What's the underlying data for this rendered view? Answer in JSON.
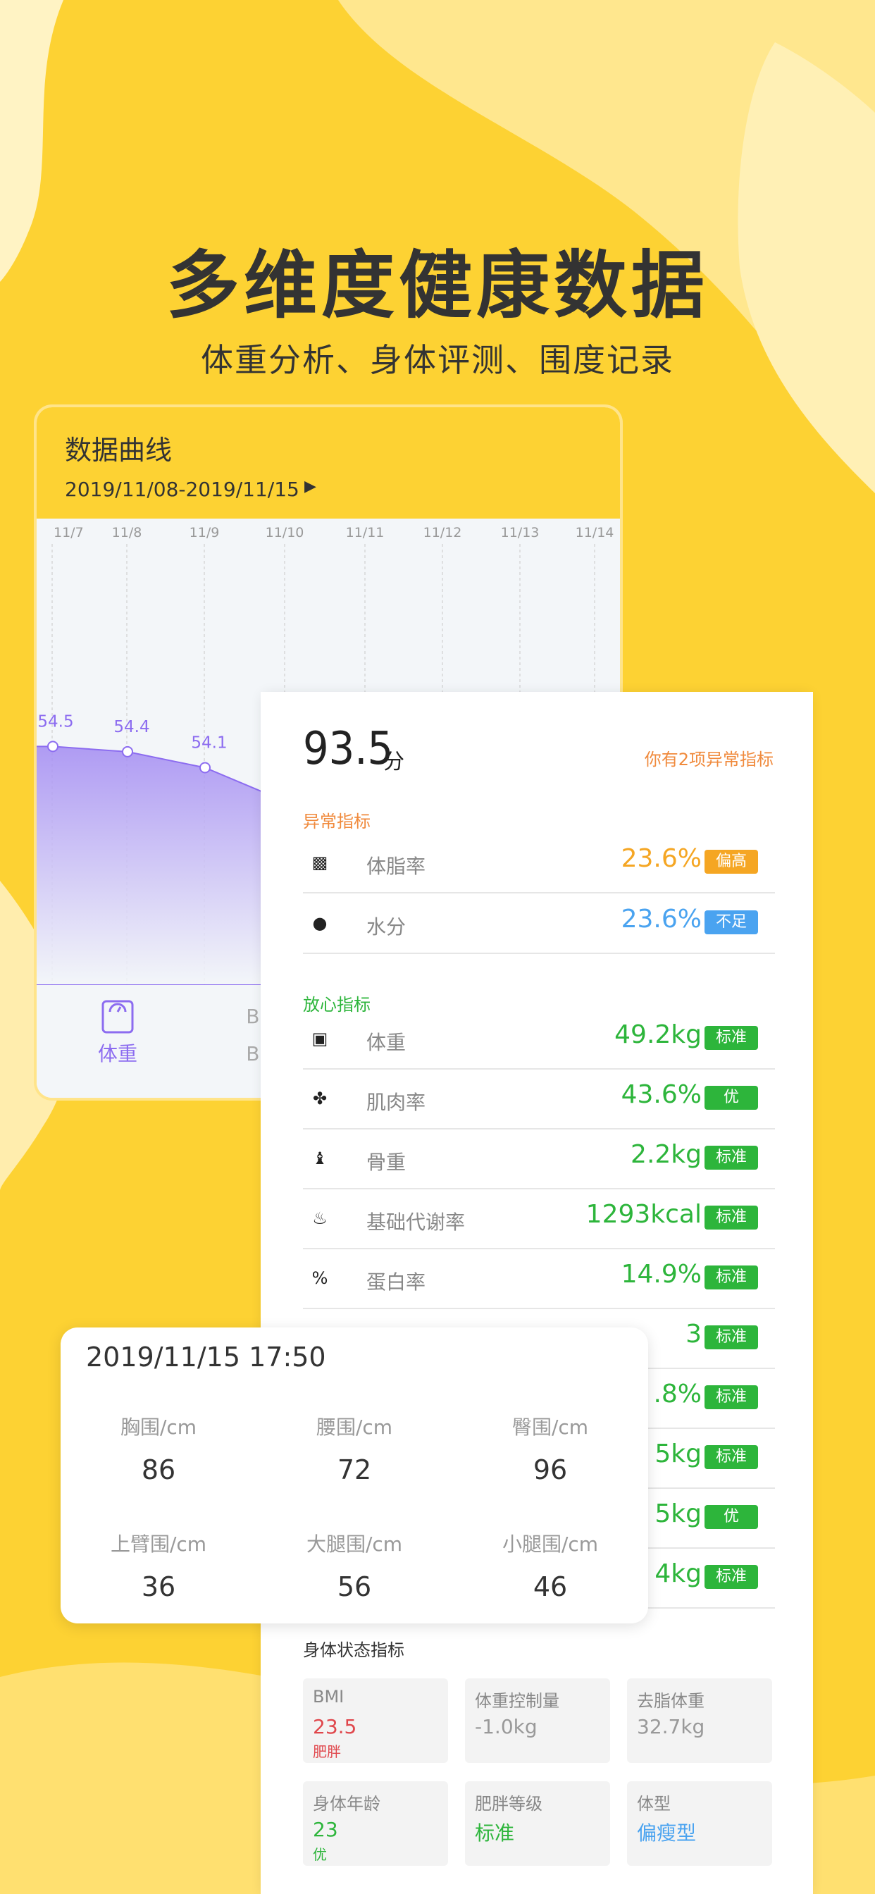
{
  "hero": {
    "title": "多维度健康数据",
    "subtitle": "体重分析、身体评测、围度记录"
  },
  "chart_card": {
    "title": "数据曲线",
    "date_range": "2019/11/08-2019/11/15",
    "arrow": "▶",
    "tabs": [
      {
        "label": "体重",
        "icon": "scale-icon",
        "active": true
      },
      {
        "label": "BMI",
        "icon": "",
        "active": false
      }
    ],
    "tab_partial_top": "BMI",
    "accent_color": "#8C6CF0"
  },
  "chart_data": {
    "type": "area",
    "x": [
      "11/7",
      "11/8",
      "11/9",
      "11/10",
      "11/11",
      "11/12",
      "11/13",
      "11/14"
    ],
    "series": [
      {
        "values": [
          54.5,
          54.4,
          54.1,
          null,
          null,
          null,
          null,
          null
        ]
      }
    ],
    "data_labels": [
      "54.5",
      "54.4",
      "54.1"
    ],
    "ylim": [
      50,
      58
    ],
    "grid": true,
    "color": "#8C6CF0"
  },
  "report": {
    "score": "93.5",
    "score_unit": "分",
    "abnormal_note": "你有2项异常指标",
    "abnormal_label": "异常指标",
    "normal_label": "放心指标",
    "colors": {
      "orange": "#F5A623",
      "blue": "#4AA3F0",
      "green": "#2DB53B",
      "section_orange": "#F08A3C"
    },
    "abnormal": [
      {
        "icon": "fat-grid-icon",
        "label": "体脂率",
        "value": "23.6%",
        "badge": "偏高",
        "color": "#F5A623"
      },
      {
        "icon": "water-drop-icon",
        "label": "水分",
        "value": "23.6%",
        "badge": "不足",
        "color": "#4AA3F0"
      }
    ],
    "normal": [
      {
        "icon": "scale-icon",
        "label": "体重",
        "value": "49.2kg",
        "badge": "标准"
      },
      {
        "icon": "muscle-icon",
        "label": "肌肉率",
        "value": "43.6%",
        "badge": "优"
      },
      {
        "icon": "bone-icon",
        "label": "骨重",
        "value": "2.2kg",
        "badge": "标准"
      },
      {
        "icon": "flame-icon",
        "label": "基础代谢率",
        "value": "1293kcal",
        "badge": "标准"
      },
      {
        "icon": "percent-icon",
        "label": "蛋白率",
        "value": "14.9%",
        "badge": "标准"
      },
      {
        "icon": "",
        "label": "",
        "value": "3",
        "badge": "标准"
      },
      {
        "icon": "",
        "label": "",
        "value": ".8%",
        "badge": "标准"
      },
      {
        "icon": "",
        "label": "",
        "value": "5kg",
        "badge": "标准"
      },
      {
        "icon": "",
        "label": "",
        "value": "5kg",
        "badge": "优"
      },
      {
        "icon": "",
        "label": "",
        "value": "4kg",
        "badge": "标准"
      }
    ],
    "status_title": "身体状态指标",
    "tiles": [
      {
        "label": "BMI",
        "value": "23.5",
        "sub": "肥胖",
        "color": "#E0474C"
      },
      {
        "label": "体重控制量",
        "value": "-1.0kg",
        "sub": "",
        "color": "#999999"
      },
      {
        "label": "去脂体重",
        "value": "32.7kg",
        "sub": "",
        "color": "#999999"
      },
      {
        "label": "身体年龄",
        "value": "23",
        "sub": "优",
        "color": "#2DB53B"
      },
      {
        "label": "肥胖等级",
        "value": "标准",
        "sub": "",
        "color": "#2DB53B"
      },
      {
        "label": "体型",
        "value": "偏瘦型",
        "sub": "",
        "color": "#4AA3F0"
      }
    ]
  },
  "measure": {
    "time": "2019/11/15 17:50",
    "items": [
      {
        "label": "胸围/cm",
        "value": "86"
      },
      {
        "label": "腰围/cm",
        "value": "72"
      },
      {
        "label": "臀围/cm",
        "value": "96"
      },
      {
        "label": "上臂围/cm",
        "value": "36"
      },
      {
        "label": "大腿围/cm",
        "value": "56"
      },
      {
        "label": "小腿围/cm",
        "value": "46"
      }
    ]
  }
}
